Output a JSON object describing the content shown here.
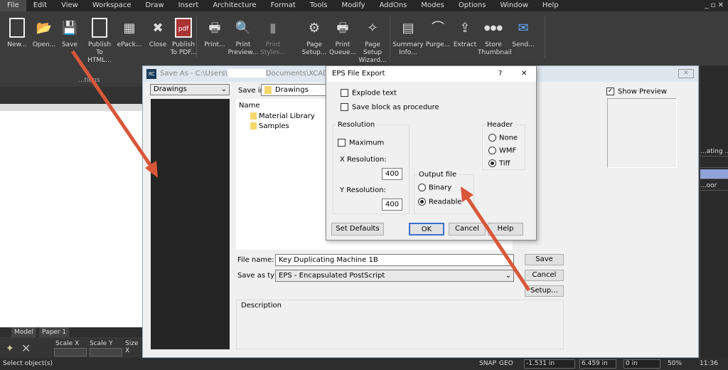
{
  "menu": [
    "File",
    "Edit",
    "View",
    "Workspace",
    "Draw",
    "Insert",
    "Architecture",
    "Format",
    "Tools",
    "Modify",
    "AddOns",
    "Modes",
    "Options",
    "Window",
    "Help"
  ],
  "window_controls": "_ ▫ ✕",
  "ribbon": {
    "buttons": [
      {
        "label": "New...",
        "icon": "new-document-icon"
      },
      {
        "label": "Open...",
        "icon": "open-folder-icon"
      },
      {
        "label": "Save",
        "icon": "floppy-disk-icon"
      },
      {
        "label": "Publish To HTML...",
        "icon": "publish-html-icon"
      },
      {
        "label": "ePack...",
        "icon": "epack-icon"
      },
      {
        "label": "Close",
        "icon": "close-document-icon"
      },
      {
        "label": "Publish To PDF...",
        "icon": "pdf-icon"
      },
      {
        "label": "Print...",
        "icon": "printer-icon"
      },
      {
        "label": "Print Preview...",
        "icon": "print-preview-icon"
      },
      {
        "label": "Print Styles...",
        "icon": "print-styles-icon",
        "disabled": true
      },
      {
        "label": "Page Setup...",
        "icon": "page-setup-icon"
      },
      {
        "label": "Print Queue...",
        "icon": "print-queue-icon"
      },
      {
        "label": "Page Setup Wizard...",
        "icon": "wizard-icon"
      },
      {
        "label": "Summary Info...",
        "icon": "summary-info-icon"
      },
      {
        "label": "Purge...",
        "icon": "purge-icon"
      },
      {
        "label": "Extract",
        "icon": "extract-icon"
      },
      {
        "label": "Store Thumbnail",
        "icon": "more-dots-icon"
      },
      {
        "label": "Send...",
        "icon": "email-icon"
      }
    ],
    "group_label": "...tions"
  },
  "tabs": {
    "model": "Model",
    "paper": "Paper 1"
  },
  "bottom_toolbar": {
    "scale_x": "Scale X",
    "scale_y": "Scale Y",
    "size_x": "Size X"
  },
  "status": {
    "message": "Select object(s)",
    "snap": "SNAP",
    "geo": "GEO",
    "x": "-1.531 in",
    "y": "6.459 in",
    "z": "0 in",
    "zoom": "50%",
    "time": "11:36"
  },
  "right_panel": {
    "items": [
      "...ating ...",
      "",
      "",
      "...oor"
    ]
  },
  "save_as": {
    "title_prefix": "Save As - C:\\Users\\",
    "title_suffix": "Documents\\XCAD 2024 x64\\Drawings\\Key Duplic...",
    "places_dropdown": "Drawings",
    "save_in_label": "Save in:",
    "save_in_value": "Drawings",
    "list_header": "Name",
    "files": [
      "Material Library",
      "Samples"
    ],
    "file_name_label": "File name:",
    "file_name_value": "Key Duplicating Machine 1B",
    "type_label": "Save as type:",
    "type_value": "EPS  - Encapsulated PostScript",
    "save_btn": "Save",
    "cancel_btn": "Cancel",
    "setup_btn": "Setup...",
    "description_label": "Description",
    "show_preview": "Show Preview",
    "show_preview_checked": true
  },
  "eps": {
    "title": "EPS File Export",
    "help": "?",
    "close": "✕",
    "explode_text": "Explode text",
    "explode_checked": false,
    "save_block": "Save block as procedure",
    "save_block_checked": false,
    "resolution_label": "Resolution",
    "maximum": "Maximum",
    "maximum_checked": false,
    "x_res_label": "X Resolution:",
    "x_res": "400",
    "y_res_label": "Y Resolution:",
    "y_res": "400",
    "header_label": "Header",
    "header_options": [
      "None",
      "WMF",
      "Tiff"
    ],
    "header_selected": "Tiff",
    "output_label": "Output file",
    "output_options": [
      "Binary",
      "Readable"
    ],
    "output_selected": "Readable",
    "set_defaults": "Set Defaults",
    "ok": "OK",
    "cancel": "Cancel",
    "help_btn": "Help"
  },
  "colors": {
    "annotation_arrow": "#d9573a",
    "ui_dark": "#3c3c3c",
    "dialog_bg": "#f0f0f0"
  }
}
